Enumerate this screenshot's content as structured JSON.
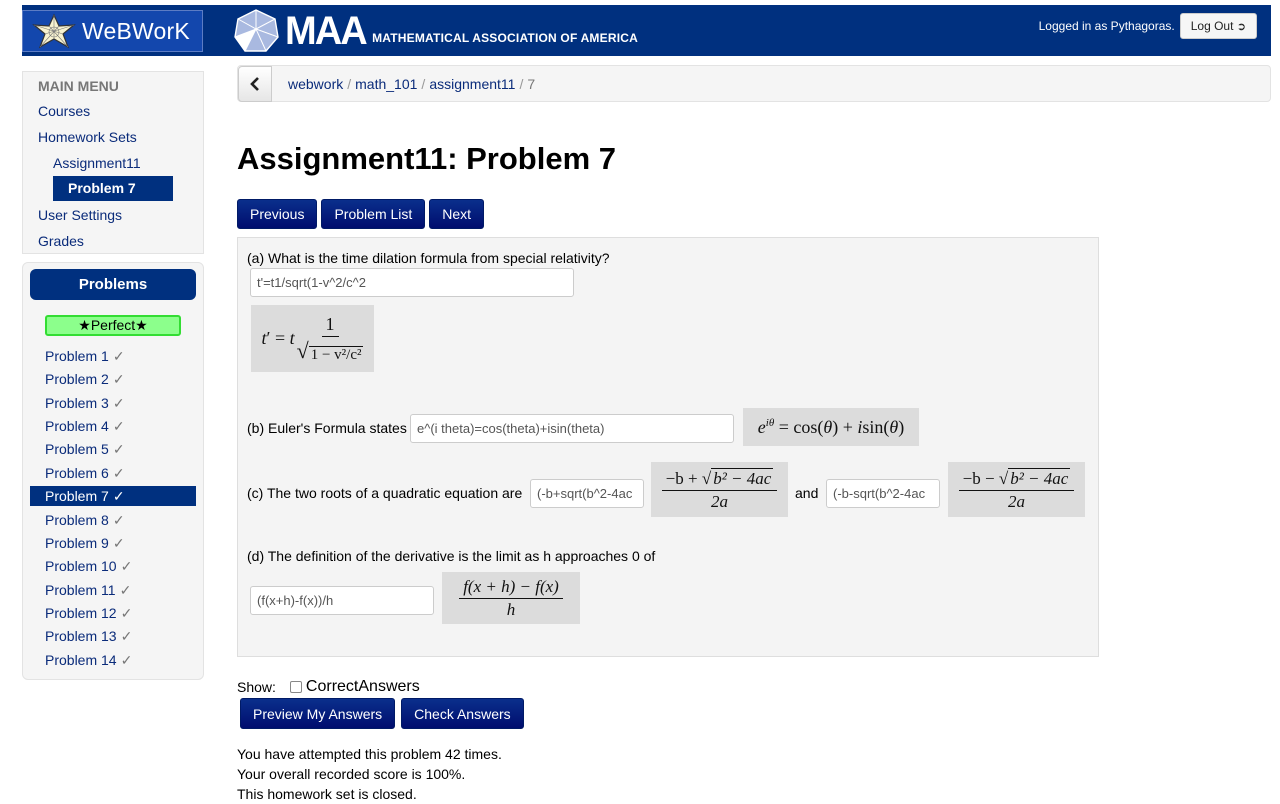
{
  "header": {
    "app_name": "WeBWorK",
    "org_short": "MAA",
    "org_full": "MATHEMATICAL ASSOCIATION OF AMERICA",
    "logged_in_text": "Logged in as Pythagoras.",
    "logout_label": "Log Out",
    "brand_color": "#00307f"
  },
  "main_menu": {
    "heading": "MAIN MENU",
    "items": [
      {
        "label": "Courses"
      },
      {
        "label": "Homework Sets"
      },
      {
        "label": "Assignment11"
      },
      {
        "label": "Problem 7",
        "active": true
      },
      {
        "label": "User Settings"
      },
      {
        "label": "Grades"
      }
    ]
  },
  "problems_panel": {
    "heading": "Problems",
    "badge": "★Perfect★",
    "check": "✓",
    "items": [
      {
        "label": "Problem 1"
      },
      {
        "label": "Problem 2"
      },
      {
        "label": "Problem 3"
      },
      {
        "label": "Problem 4"
      },
      {
        "label": "Problem 5"
      },
      {
        "label": "Problem 6"
      },
      {
        "label": "Problem 7",
        "active": true
      },
      {
        "label": "Problem 8"
      },
      {
        "label": "Problem 9"
      },
      {
        "label": "Problem 10"
      },
      {
        "label": "Problem 11"
      },
      {
        "label": "Problem 12"
      },
      {
        "label": "Problem 13"
      },
      {
        "label": "Problem 14"
      }
    ]
  },
  "breadcrumb": {
    "back_icon": "chevron-left",
    "items": [
      "webwork",
      "math_101",
      "assignment11",
      "7"
    ],
    "separator": "/"
  },
  "page_title": "Assignment11: Problem 7",
  "nav": {
    "previous": "Previous",
    "problem_list": "Problem List",
    "next": "Next"
  },
  "problem": {
    "a": {
      "prompt": "(a) What is the time dilation formula from special relativity?",
      "answer": "t'=t1/sqrt(1-v^2/c^2",
      "preview": {
        "lhs": "t′ = t",
        "num": "1",
        "rad": "1 − v²/c²"
      }
    },
    "b": {
      "prompt": "(b) Euler's Formula states",
      "answer": "e^(i theta)=cos(theta)+isin(theta)",
      "preview": "e^{iθ} = cos(θ) + i sin(θ)"
    },
    "c": {
      "prompt": "(c) The two roots of a quadratic equation are",
      "answer1": "(-b+sqrt(b^2-4ac",
      "answer2": "(-b-sqrt(b^2-4ac",
      "connector": "and",
      "preview1": {
        "num_prefix": "−b + ",
        "rad": "b² − 4ac",
        "den": "2a"
      },
      "preview2": {
        "num_prefix": "−b − ",
        "rad": "b² − 4ac",
        "den": "2a"
      }
    },
    "d": {
      "prompt": "(d) The definition of the derivative is the limit as h approaches 0 of",
      "answer": "(f(x+h)-f(x))/h",
      "preview": {
        "num": "f(x + h) − f(x)",
        "den": "h"
      }
    }
  },
  "show": {
    "label": "Show:",
    "checkbox_label": "CorrectAnswers",
    "checked": false
  },
  "actions": {
    "preview": "Preview My Answers",
    "check": "Check Answers"
  },
  "status": {
    "attempts": "You have attempted this problem 42 times.",
    "score": "Your overall recorded score is 100%.",
    "closed": "This homework set is closed."
  }
}
